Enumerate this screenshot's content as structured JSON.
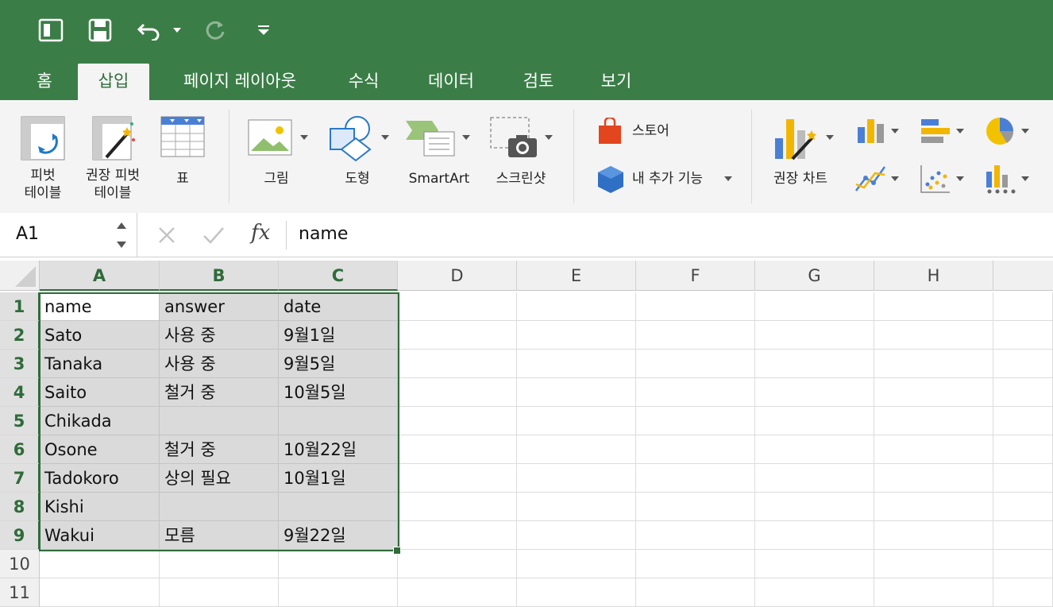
{
  "quick_access": {
    "icons": [
      "sidebar-icon",
      "save-icon",
      "undo-icon",
      "redo-icon",
      "customize-icon"
    ]
  },
  "tabs": [
    {
      "label": "홈",
      "active": false
    },
    {
      "label": "삽입",
      "active": true
    },
    {
      "label": "페이지 레이아웃",
      "active": false
    },
    {
      "label": "수식",
      "active": false
    },
    {
      "label": "데이터",
      "active": false
    },
    {
      "label": "검토",
      "active": false
    },
    {
      "label": "보기",
      "active": false
    }
  ],
  "ribbon": {
    "pivot_table": "피벗\n테이블",
    "recommended_pivot": "권장 피벗\n테이블",
    "table": "표",
    "picture": "그림",
    "shapes": "도형",
    "smartart": "SmartArt",
    "screenshot": "스크린샷",
    "store": "스토어",
    "my_addins": "내 추가 기능",
    "recommended_charts": "권장 차트"
  },
  "formula_bar": {
    "name_box": "A1",
    "fx": "fx",
    "formula": "name"
  },
  "columns": [
    "A",
    "B",
    "C",
    "D",
    "E",
    "F",
    "G",
    "H"
  ],
  "selected_columns": [
    "A",
    "B",
    "C"
  ],
  "rows": [
    "1",
    "2",
    "3",
    "4",
    "5",
    "6",
    "7",
    "8",
    "9",
    "10",
    "11"
  ],
  "selected_rows": [
    "1",
    "2",
    "3",
    "4",
    "5",
    "6",
    "7",
    "8",
    "9"
  ],
  "cells": [
    [
      "name",
      "answer",
      "date"
    ],
    [
      "Sato",
      "사용 중",
      "9월1일"
    ],
    [
      "Tanaka",
      "사용 중",
      "9월5일"
    ],
    [
      "Saito",
      "철거 중",
      "10월5일"
    ],
    [
      "Chikada",
      "",
      ""
    ],
    [
      "Osone",
      "철거 중",
      "10월22일"
    ],
    [
      "Tadokoro",
      "상의 필요",
      "10월1일"
    ],
    [
      "Kishi",
      "",
      ""
    ],
    [
      "Wakui",
      "모름",
      "9월22일"
    ]
  ],
  "colors": {
    "accent": "#3b7d47",
    "selection": "#2f6b3a"
  }
}
